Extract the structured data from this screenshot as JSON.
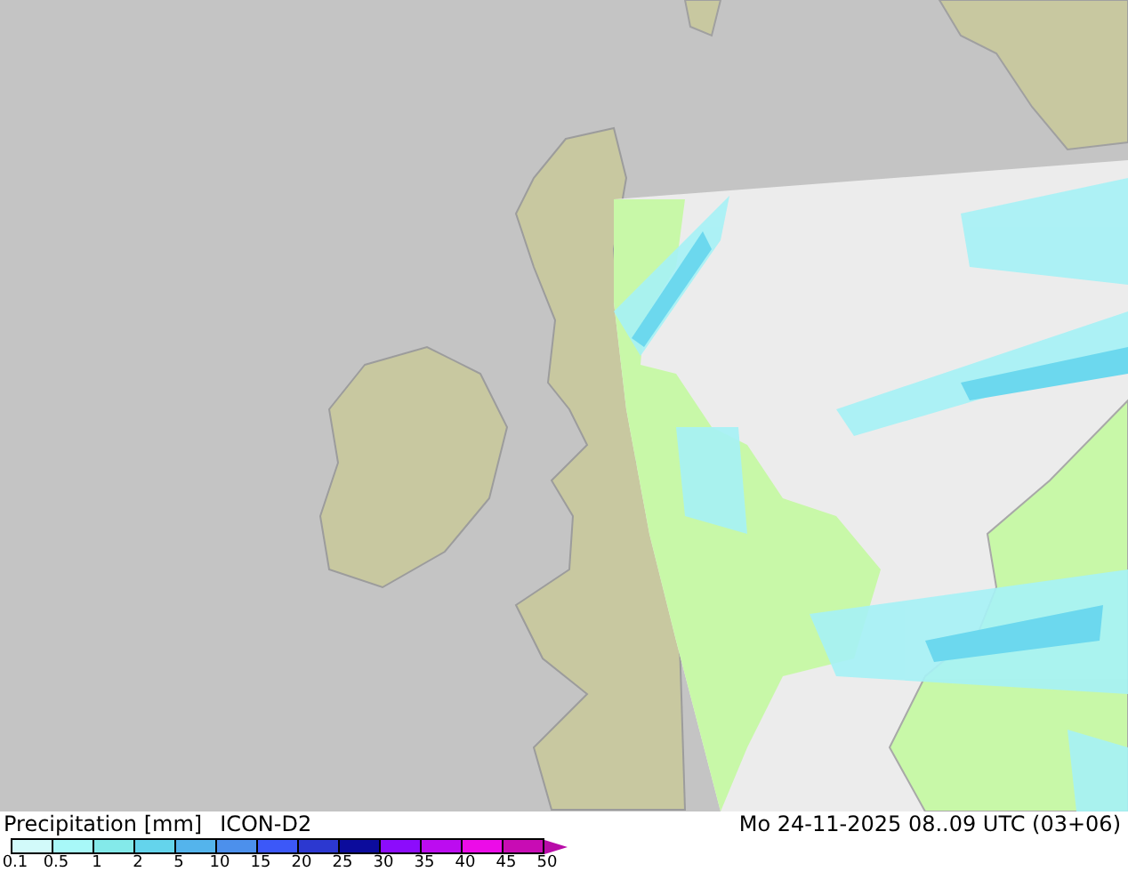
{
  "legend": {
    "title": "Precipitation [mm]",
    "model": "ICON-D2",
    "bins": [
      {
        "color": "#d2fafa"
      },
      {
        "color": "#a8f8f8"
      },
      {
        "color": "#84eaea"
      },
      {
        "color": "#64d4ec"
      },
      {
        "color": "#54b4ec"
      },
      {
        "color": "#4c90ec"
      },
      {
        "color": "#3c58f8"
      },
      {
        "color": "#2c38d0"
      },
      {
        "color": "#0c0c9c"
      },
      {
        "color": "#8c0cfc"
      },
      {
        "color": "#bc0cf0"
      },
      {
        "color": "#ec0ce8"
      },
      {
        "color": "#c80cb4"
      }
    ],
    "ticks": [
      "0.1",
      "0.5",
      "1",
      "2",
      "5",
      "10",
      "15",
      "20",
      "25",
      "30",
      "35",
      "40",
      "45",
      "50"
    ],
    "overflow_arrow": {
      "color": "#b80ca8"
    }
  },
  "valid_time": "Mo 24-11-2025 08..09 UTC (03+06)"
}
